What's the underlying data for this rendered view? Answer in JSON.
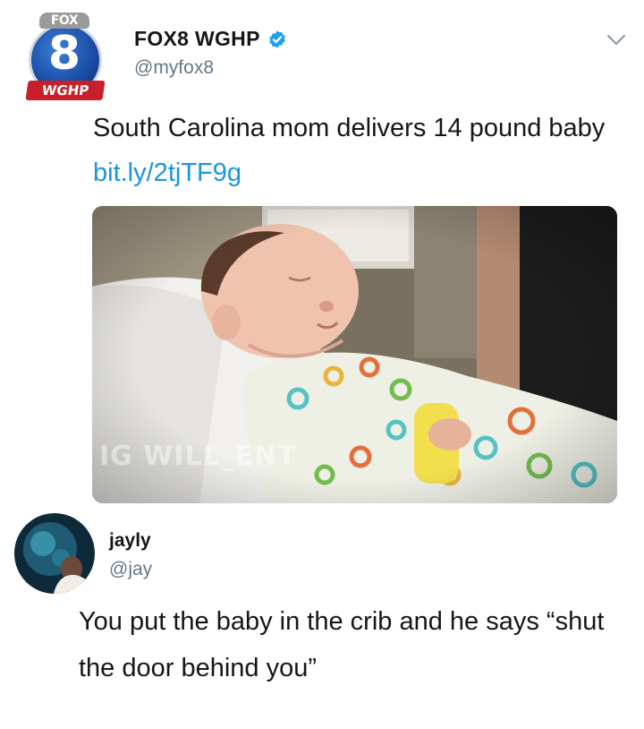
{
  "tweet": {
    "avatar": {
      "badge_top": "FOX",
      "badge_number": "8",
      "badge_bottom": "WGHP"
    },
    "display_name": "FOX8 WGHP",
    "handle": "@myfox8",
    "text": "South Carolina mom delivers 14 pound baby ",
    "link": "bit.ly/2tjTF9g",
    "media": {
      "watermark": "IG WILL_ENT"
    }
  },
  "reply": {
    "display_name": "jayly",
    "handle": "@jay",
    "text": "You put the baby in the crib and he says “shut the door behind you”"
  },
  "colors": {
    "link": "#1b95e0",
    "verified": "#1da1f2",
    "secondary_text": "#657786"
  },
  "icons": [
    "fox8-logo",
    "verified-badge-icon",
    "chevron-down-icon"
  ]
}
